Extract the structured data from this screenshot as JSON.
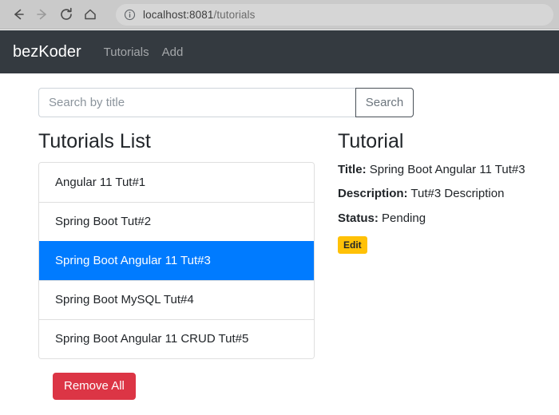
{
  "browser": {
    "back_icon": "back-arrow-icon",
    "forward_icon": "forward-arrow-icon",
    "reload_icon": "reload-icon",
    "home_icon": "home-icon",
    "info_icon": "site-info-icon",
    "url_host": "localhost:8081",
    "url_path": "/tutorials"
  },
  "navbar": {
    "brand": "bezKoder",
    "links": [
      {
        "label": "Tutorials"
      },
      {
        "label": "Add"
      }
    ]
  },
  "search": {
    "value": "",
    "placeholder": "Search by title",
    "button_label": "Search"
  },
  "list_panel": {
    "title": "Tutorials List",
    "items": [
      {
        "label": "Angular 11 Tut#1",
        "active": false
      },
      {
        "label": "Spring Boot Tut#2",
        "active": false
      },
      {
        "label": "Spring Boot Angular 11 Tut#3",
        "active": true
      },
      {
        "label": "Spring Boot MySQL Tut#4",
        "active": false
      },
      {
        "label": "Spring Boot Angular 11 CRUD Tut#5",
        "active": false
      }
    ],
    "remove_all_label": "Remove All"
  },
  "detail_panel": {
    "title": "Tutorial",
    "title_label": "Title:",
    "title_value": "Spring Boot Angular 11 Tut#3",
    "description_label": "Description:",
    "description_value": "Tut#3 Description",
    "status_label": "Status:",
    "status_value": "Pending",
    "edit_label": "Edit"
  },
  "colors": {
    "navbar_bg": "#343a40",
    "active_item": "#007bff",
    "danger": "#dc3545",
    "warning": "#ffc107",
    "toolbar_bg": "#cacaca"
  }
}
